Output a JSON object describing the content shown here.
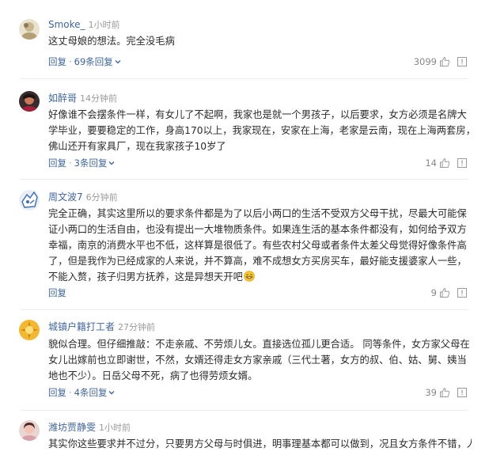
{
  "comments": [
    {
      "user": "Smoke_",
      "time": "1小时前",
      "text": "这丈母娘的想法。完全没毛病",
      "reply": "回复",
      "replies": "69条回复",
      "likes": "3099"
    },
    {
      "user": "如醉哥",
      "time": "14分钟前",
      "text": "好像谁不会摆条件一样，有女儿了不起啊，我家也是就一个男孩子，以后要求，女方必须是名牌大学毕业，要要稳定的工作，身高170以上，我家现在，安家在上海，老家是云南，现在上海两套房，佛山还开有家具厂，现在我家孩子10岁了",
      "reply": "回复",
      "replies": "3条回复",
      "likes": "14"
    },
    {
      "user": "周文波7",
      "time": "6分钟前",
      "text": "完全正确，其实这里所以的要求条件都是为了以后小两口的生活不受双方父母干扰，尽最大可能保证小两口的生活自由，也没有提出一大堆物质条件。如果连生活的基本条件都没有，如何给予双方幸福，南京的消费水平也不低，这样算是很低了。有些农村父母或者条件太差父母觉得好像条件高了，但是我作为已经成家的人来说，并不算高，难不成想女方买房买车，最好能支援婆家人一些，不能入赘，孩子归男方抚养，这是异想天开吧",
      "emoji": "grin-emoji",
      "reply": "回复",
      "replies": "",
      "likes": "9"
    },
    {
      "user": "城镇户籍打工者",
      "time": "27分钟前",
      "text": "貌似合理。但仔细推敲：不走亲戚、不劳烦儿女。直接选位孤儿更合适。 同等条件，女方家父母在女儿出嫁前也立即谢世，不然，女婿还得走女方家亲戚（三代土著，女方的叔、伯、姑、舅、姨当地也不少）。日岳父母不死，病了也得劳烦女婿。",
      "reply": "回复",
      "replies": "4条回复",
      "likes": "39"
    },
    {
      "user": "潍坊贾静雯",
      "time": "1小时前",
      "text": "其实你这些要求并不过分，只要男方父母与时俱进，明事理基本都可以做到，况且女方条件不错，人"
    }
  ],
  "icons": {
    "like": "thumbs-up-icon",
    "report": "report-icon",
    "expand": "chevron-down-icon"
  },
  "colors": {
    "link": "#406599",
    "meta": "#9a9a9a",
    "text": "#2b2b2b"
  }
}
